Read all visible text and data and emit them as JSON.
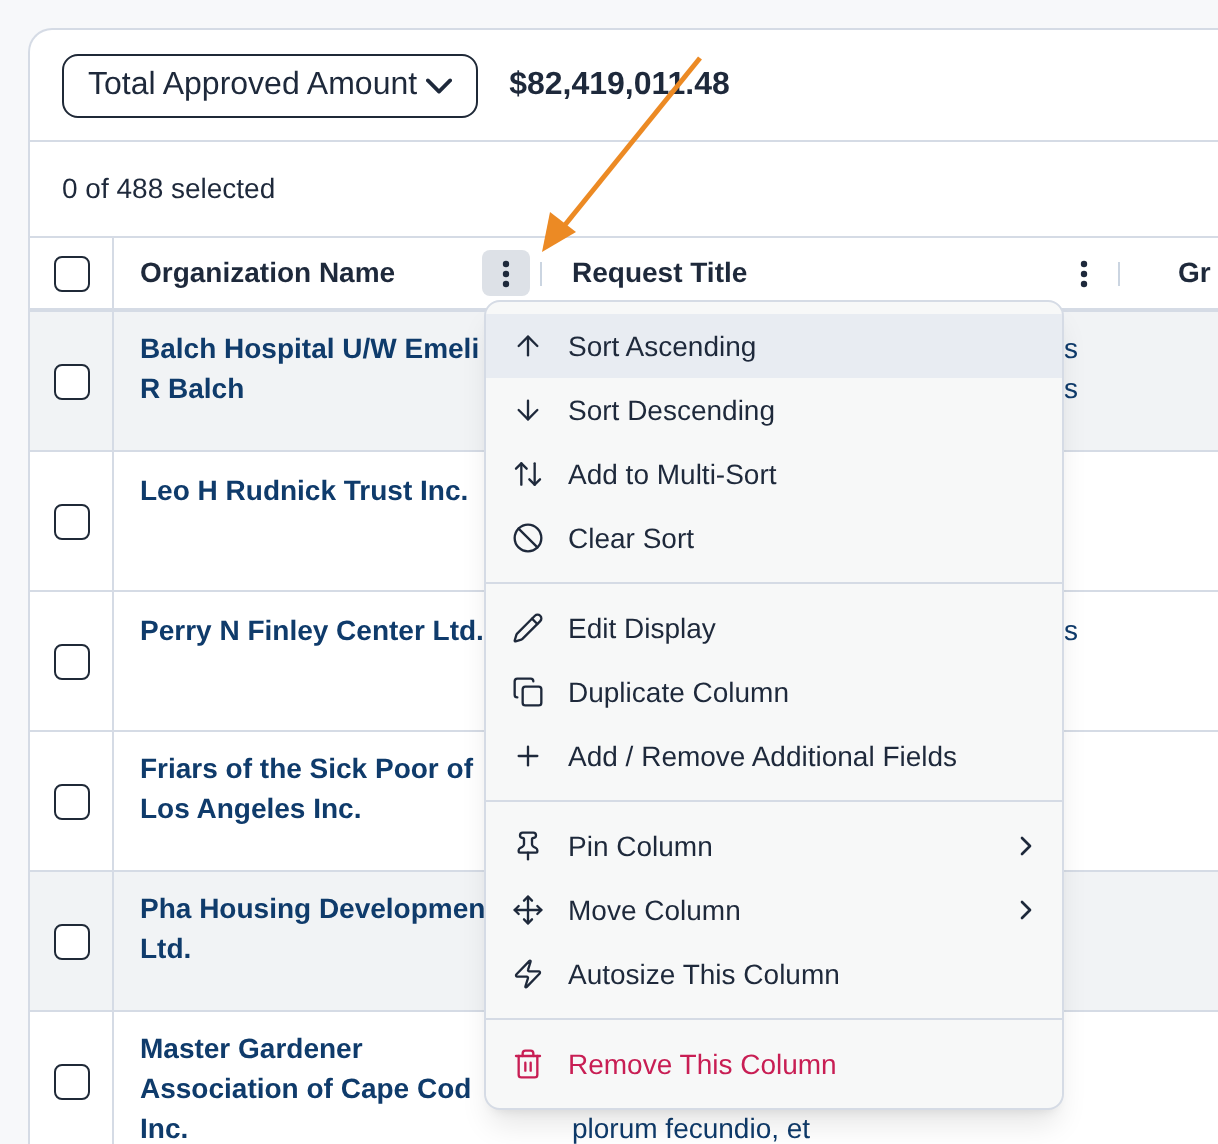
{
  "summary": {
    "metric": "Total Approved Amount",
    "amount": "$82,419,011.48"
  },
  "selection": "0 of 488 selected",
  "header": {
    "checked": false,
    "columns": [
      {
        "label": "Organization Name",
        "menu_open": true
      },
      {
        "label": "Request Title",
        "menu_open": false
      },
      {
        "label": "Gr"
      }
    ]
  },
  "rows": [
    {
      "checked": false,
      "shaded": true,
      "organization": [
        "Balch Hospital U/W Emeli",
        "R Balch"
      ],
      "request_title": {
        "kind": "covered",
        "lines": [
          "s",
          "s"
        ]
      }
    },
    {
      "checked": false,
      "shaded": false,
      "organization": [
        "Leo H Rudnick Trust Inc."
      ]
    },
    {
      "checked": false,
      "shaded": false,
      "organization": [
        "Perry N Finley Center Ltd."
      ],
      "request_title": {
        "kind": "covered",
        "lines": [
          "s"
        ]
      }
    },
    {
      "checked": false,
      "shaded": false,
      "organization": [
        "Friars of the Sick Poor of",
        "Los Angeles Inc."
      ]
    },
    {
      "checked": false,
      "shaded": true,
      "organization": [
        "Pha Housing Developmen",
        "Ltd."
      ]
    },
    {
      "checked": false,
      "shaded": false,
      "organization": [
        "Master Gardener",
        "Association of Cape Cod",
        "Inc."
      ],
      "request_title": {
        "kind": "below",
        "lines": [
          "plorum fecundio, et"
        ]
      }
    }
  ],
  "column_menu": {
    "groups": [
      [
        {
          "label": "Sort Ascending",
          "selected": true,
          "submenu": false,
          "kind": "normal"
        },
        {
          "label": "Sort Descending",
          "selected": false,
          "submenu": false,
          "kind": "normal"
        },
        {
          "label": "Add to Multi-Sort",
          "selected": false,
          "submenu": false,
          "kind": "normal"
        },
        {
          "label": "Clear Sort",
          "selected": false,
          "submenu": false,
          "kind": "normal"
        }
      ],
      [
        {
          "label": "Edit Display",
          "selected": false,
          "submenu": false,
          "kind": "normal"
        },
        {
          "label": "Duplicate Column",
          "selected": false,
          "submenu": false,
          "kind": "normal"
        },
        {
          "label": "Add / Remove Additional Fields",
          "selected": false,
          "submenu": false,
          "kind": "normal"
        }
      ],
      [
        {
          "label": "Pin Column",
          "selected": false,
          "submenu": true,
          "kind": "normal"
        },
        {
          "label": "Move Column",
          "selected": false,
          "submenu": true,
          "kind": "normal"
        },
        {
          "label": "Autosize This Column",
          "selected": false,
          "submenu": false,
          "kind": "normal"
        }
      ],
      [
        {
          "label": "Remove This Column",
          "selected": false,
          "submenu": false,
          "kind": "danger"
        }
      ]
    ]
  }
}
